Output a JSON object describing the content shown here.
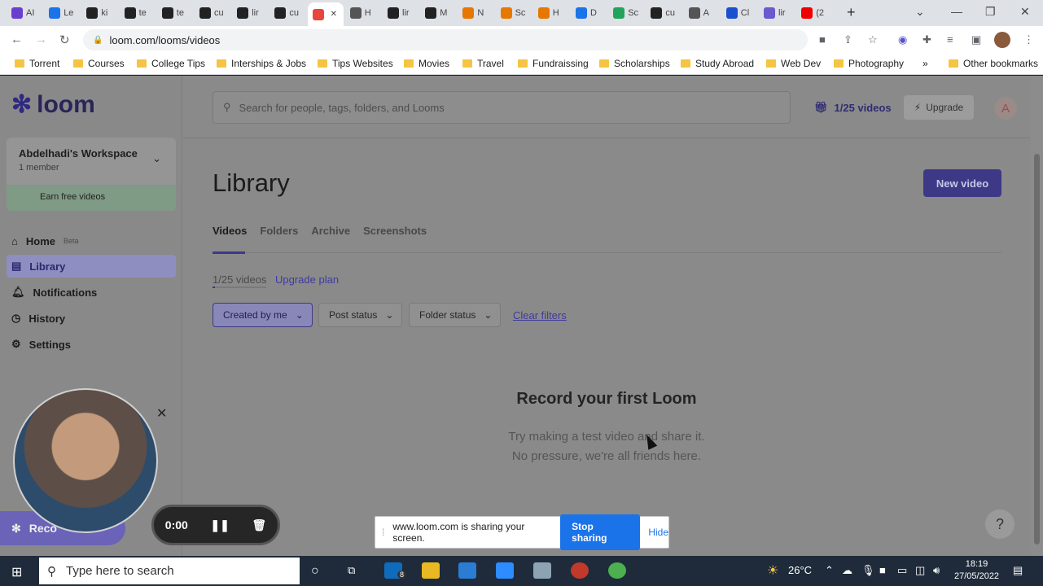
{
  "browser": {
    "tabs": [
      {
        "label": "AI",
        "color": "#6a3fd0"
      },
      {
        "label": "Le",
        "color": "#1a73e8"
      },
      {
        "label": "ki",
        "color": "#222"
      },
      {
        "label": "te",
        "color": "#222"
      },
      {
        "label": "te",
        "color": "#222"
      },
      {
        "label": "cu",
        "color": "#222"
      },
      {
        "label": "lir",
        "color": "#222"
      },
      {
        "label": "cu",
        "color": "#222"
      },
      {
        "label": "",
        "color": "#e8453c",
        "active": true
      },
      {
        "label": "H",
        "color": "#555"
      },
      {
        "label": "lir",
        "color": "#222"
      },
      {
        "label": "M",
        "color": "#222"
      },
      {
        "label": "N",
        "color": "#e67700"
      },
      {
        "label": "Sc",
        "color": "#e67700"
      },
      {
        "label": "H",
        "color": "#e67700"
      },
      {
        "label": "D",
        "color": "#1a73e8"
      },
      {
        "label": "Sc",
        "color": "#22a35a"
      },
      {
        "label": "cu",
        "color": "#222"
      },
      {
        "label": "A",
        "color": "#555"
      },
      {
        "label": "Cl",
        "color": "#1a4fd0"
      },
      {
        "label": "lir",
        "color": "#6a5acd"
      },
      {
        "label": "(2",
        "color": "#e00"
      }
    ],
    "url": "loom.com/looms/videos",
    "bookmarks": [
      "Torrent",
      "Courses",
      "College Tips",
      "Interships & Jobs",
      "Tips Websites",
      "Movies",
      "Travel",
      "Fundraissing",
      "Scholarships",
      "Study Abroad",
      "Web Dev",
      "Photography"
    ],
    "other_bookmarks": "Other bookmarks"
  },
  "sidebar": {
    "logo": "loom",
    "workspace_name": "Abdelhadi's Workspace",
    "workspace_members": "1 member",
    "earn": "Earn free videos",
    "nav": [
      {
        "label": "Home",
        "badge": "Beta"
      },
      {
        "label": "Library",
        "badge": ""
      },
      {
        "label": "Notifications",
        "badge": ""
      },
      {
        "label": "History",
        "badge": ""
      },
      {
        "label": "Settings",
        "badge": ""
      }
    ]
  },
  "header": {
    "search_placeholder": "Search for people, tags, folders, and Looms",
    "video_count": "1/25 videos",
    "upgrade": "Upgrade",
    "avatar_initial": "A"
  },
  "library": {
    "title": "Library",
    "new_video": "New video",
    "tabs": [
      "Videos",
      "Folders",
      "Archive",
      "Screenshots"
    ],
    "limit": "1/25 videos",
    "limit_fraction": 0.04,
    "upgrade_plan": "Upgrade plan",
    "filters": [
      "Created by me",
      "Post status",
      "Folder status"
    ],
    "clear_filters": "Clear filters",
    "empty_title": "Record your first Loom",
    "empty_line1": "Try making a test video and share it.",
    "empty_line2": "No pressure, we're all friends here.",
    "help": "?"
  },
  "recorder": {
    "record_label": "Reco",
    "timer": "0:00"
  },
  "sharing": {
    "message": "www.loom.com is sharing your screen.",
    "stop": "Stop sharing",
    "hide": "Hide"
  },
  "taskbar": {
    "search_placeholder": "Type here to search",
    "mail_badge": "8",
    "temperature": "26°C",
    "time": "18:19",
    "date": "27/05/2022"
  }
}
